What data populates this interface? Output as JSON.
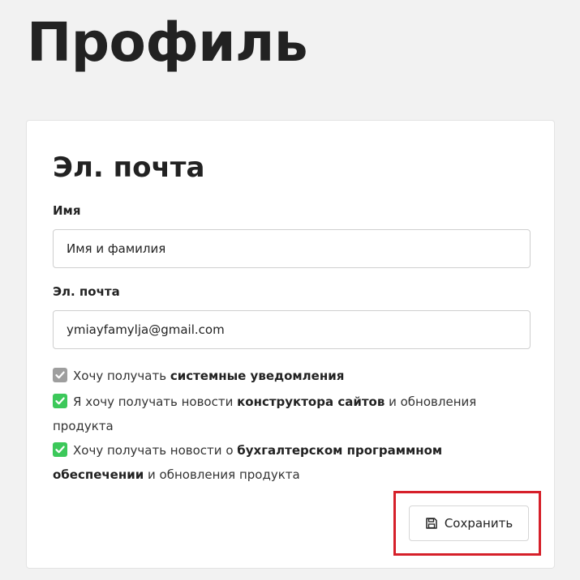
{
  "page": {
    "title": "Профиль"
  },
  "card": {
    "title": "Эл. почта",
    "name_field": {
      "label": "Имя",
      "placeholder": "Имя и фамилия",
      "value": ""
    },
    "email_field": {
      "label": "Эл. почта",
      "value": "ymiayfamylja@gmail.com"
    },
    "checkboxes": [
      {
        "checked": true,
        "disabled": true,
        "text_before": "Хочу получать ",
        "bold": "системные уведомления",
        "text_after": ""
      },
      {
        "checked": true,
        "disabled": false,
        "text_before": "Я хочу получать новости ",
        "bold": "конструктора сайтов",
        "text_after": " и обновления продукта"
      },
      {
        "checked": true,
        "disabled": false,
        "text_before": "Хочу получать новости о ",
        "bold": "бухгалтерском программном обеспечении",
        "text_after": " и обновления продукта"
      }
    ],
    "save_button": {
      "label": "Сохранить",
      "icon": "floppy-disk-icon"
    }
  },
  "colors": {
    "background": "#f2f2f2",
    "checkbox_enabled": "#3cc85a",
    "checkbox_disabled": "#9e9e9e",
    "highlight": "#d6202a"
  }
}
